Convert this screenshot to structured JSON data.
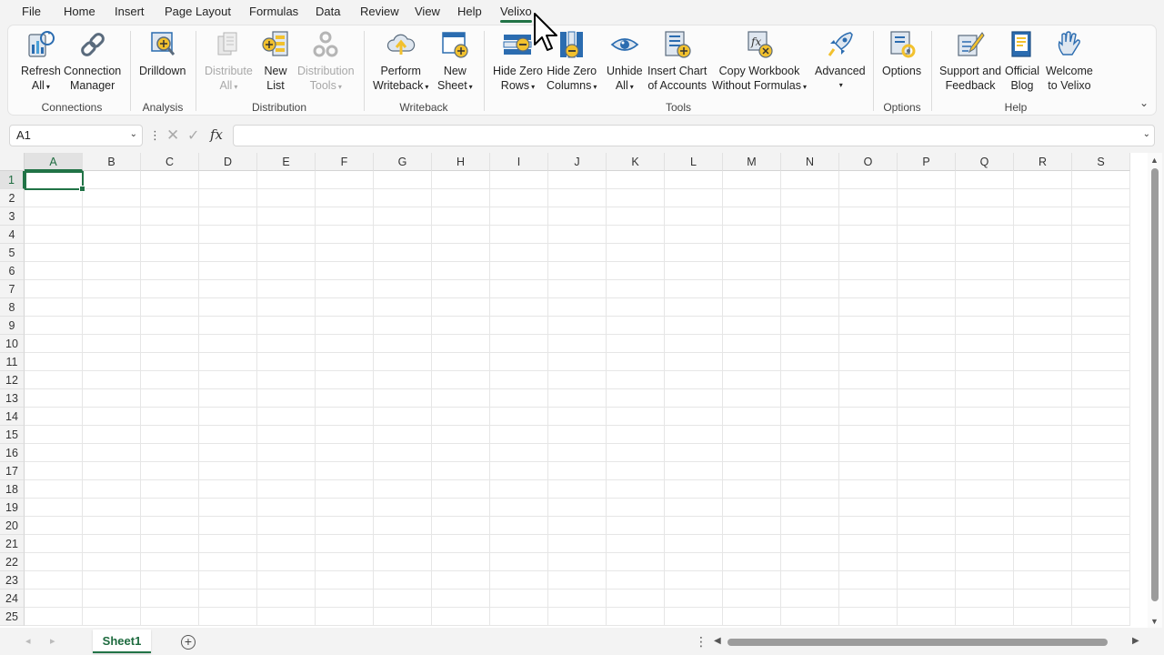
{
  "menu": {
    "tabs": [
      "File",
      "Home",
      "Insert",
      "Page Layout",
      "Formulas",
      "Data",
      "Review",
      "View",
      "Help",
      "Velixo"
    ],
    "active": "Velixo"
  },
  "ribbon": {
    "refresh_all": [
      "Refresh",
      "All"
    ],
    "connection_manager": [
      "Connection",
      "Manager"
    ],
    "drilldown": [
      "Drilldown"
    ],
    "distribute_all": [
      "Distribute",
      "All"
    ],
    "new_list": [
      "New",
      "List"
    ],
    "distribution_tools": [
      "Distribution",
      "Tools"
    ],
    "perform_writeback": [
      "Perform",
      "Writeback"
    ],
    "new_sheet": [
      "New",
      "Sheet"
    ],
    "hide_zero_rows": [
      "Hide Zero",
      "Rows"
    ],
    "hide_zero_columns": [
      "Hide Zero",
      "Columns"
    ],
    "unhide_all": [
      "Unhide",
      "All"
    ],
    "insert_chart": [
      "Insert Chart",
      "of Accounts"
    ],
    "copy_workbook": [
      "Copy Workbook",
      "Without Formulas"
    ],
    "advanced": [
      "Advanced"
    ],
    "options": [
      "Options"
    ],
    "support": [
      "Support and",
      "Feedback"
    ],
    "official_blog": [
      "Official",
      "Blog"
    ],
    "welcome": [
      "Welcome",
      "to Velixo"
    ],
    "groups": {
      "connections": "Connections",
      "analysis": "Analysis",
      "distribution": "Distribution",
      "writeback": "Writeback",
      "tools": "Tools",
      "options": "Options",
      "help": "Help"
    }
  },
  "formula_bar": {
    "name_box": "A1",
    "formula": "",
    "fx_label": "fx"
  },
  "grid": {
    "columns": [
      "A",
      "B",
      "C",
      "D",
      "E",
      "F",
      "G",
      "H",
      "I",
      "J",
      "K",
      "L",
      "M",
      "N",
      "O",
      "P",
      "Q",
      "R",
      "S"
    ],
    "rows": [
      "1",
      "2",
      "3",
      "4",
      "5",
      "6",
      "7",
      "8",
      "9",
      "10",
      "11",
      "12",
      "13",
      "14",
      "15",
      "16",
      "17",
      "18",
      "19",
      "20",
      "21",
      "22",
      "23",
      "24",
      "25"
    ],
    "selected_cell": "A1"
  },
  "sheets": {
    "tabs": [
      "Sheet1"
    ],
    "active": "Sheet1"
  },
  "colors": {
    "accent": "#217346",
    "ribbon_blue": "#2b6cb0",
    "icon_yellow": "#f2c12e"
  },
  "icons": {
    "refresh_all": "database-refresh-icon",
    "connection_manager": "chain-link-icon",
    "drilldown": "magnify-plus-icon",
    "distribute_all": "documents-icon",
    "new_list": "list-plus-icon",
    "distribution_tools": "gears-icon",
    "perform_writeback": "cloud-upload-icon",
    "new_sheet": "sheet-plus-icon",
    "hide_zero_rows": "rows-minus-icon",
    "hide_zero_columns": "columns-minus-icon",
    "unhide_all": "eye-icon",
    "insert_chart": "chart-of-accounts-icon",
    "copy_workbook": "fx-remove-icon",
    "advanced": "rocket-icon",
    "options": "options-gear-icon",
    "support": "pencil-document-icon",
    "official_blog": "book-icon",
    "welcome": "waving-hand-icon"
  }
}
